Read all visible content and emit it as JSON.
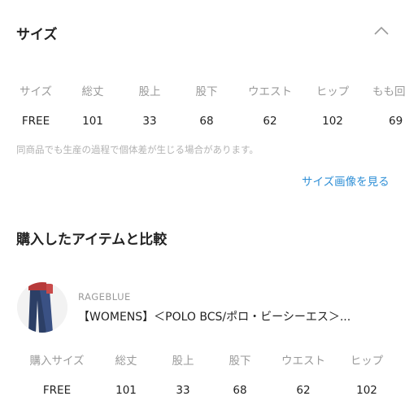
{
  "size_section": {
    "title": "サイズ",
    "headers": [
      "サイズ",
      "総丈",
      "股上",
      "股下",
      "ウエスト",
      "ヒップ",
      "もも回"
    ],
    "row": [
      "FREE",
      "101",
      "33",
      "68",
      "62",
      "102",
      "69"
    ],
    "note": "同商品でも生産の過程で個体差が生じる場合があります。",
    "image_link": "サイズ画像を見る"
  },
  "compare_section": {
    "title": "購入したアイテムと比較",
    "brand": "RAGEBLUE",
    "product_name": "【WOMENS】＜POLO BCS/ポロ・ビーシーエス＞...",
    "headers": [
      "購入サイズ",
      "総丈",
      "股上",
      "股下",
      "ウエスト",
      "ヒップ"
    ],
    "row": [
      "FREE",
      "101",
      "33",
      "68",
      "62",
      "102"
    ]
  },
  "colors": {
    "link": "#2f8fd6",
    "muted": "#9a9a9a",
    "text": "#222222"
  }
}
